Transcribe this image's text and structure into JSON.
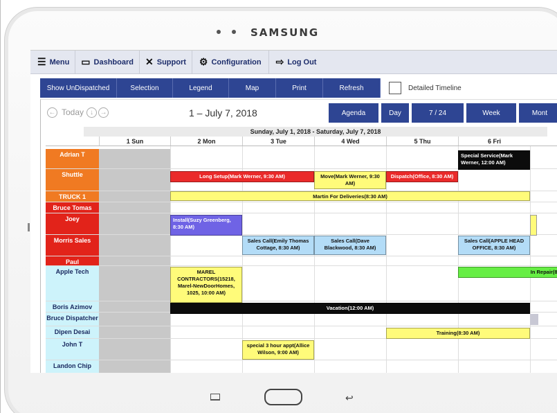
{
  "device": {
    "brand": "SAMSUNG"
  },
  "menu": [
    {
      "label": "Menu",
      "icon": "hamburger-icon"
    },
    {
      "label": "Dashboard",
      "icon": "chart-icon"
    },
    {
      "label": "Support",
      "icon": "tools-icon"
    },
    {
      "label": "Configuration",
      "icon": "gears-icon"
    },
    {
      "label": "Log Out",
      "icon": "logout-icon"
    }
  ],
  "toolbar": {
    "buttons": [
      "Show UnDispatched",
      "Selection",
      "Legend",
      "Map",
      "Print",
      "Refresh"
    ],
    "detailed_timeline": "Detailed Timeline"
  },
  "nav": {
    "today": "Today",
    "range": "1 – July 7, 2018",
    "views": [
      "Agenda",
      "Day",
      "7 / 24",
      "Week",
      "Mont"
    ]
  },
  "week_header": "Sunday, July 1, 2018 - Saturday, July 7, 2018",
  "days": [
    "1 Sun",
    "2 Mon",
    "3 Tue",
    "4 Wed",
    "5 Thu",
    "6 Fri"
  ],
  "colors": {
    "accent": "#2e4593",
    "resource_orange": "#f07a22",
    "resource_red": "#e2231a",
    "resource_cyan": "#cdf3fb",
    "event_yellow": "#fffb7a",
    "event_red": "#ea2a2a",
    "event_blue": "#b3dcf7",
    "event_purple": "#6f63e5",
    "event_green": "#66ee44",
    "event_black": "#0c0c0c"
  },
  "resources": [
    {
      "name": "Adrian T",
      "color": "#f07a22"
    },
    {
      "name": "Shuttle",
      "color": "#f07a22"
    },
    {
      "name": "TRUCK 1",
      "color": "#f07a22"
    },
    {
      "name": "Bruce Tomas",
      "color": "#e2231a"
    },
    {
      "name": "Joey",
      "color": "#e2231a"
    },
    {
      "name": "Morris Sales",
      "color": "#e2231a"
    },
    {
      "name": "Paul",
      "color": "#e2231a"
    },
    {
      "name": "Apple Tech",
      "color": "#cdf3fb"
    },
    {
      "name": "Boris Azimov",
      "color": "#cdf3fb"
    },
    {
      "name": "Bruce Dispatcher",
      "color": "#cdf3fb"
    },
    {
      "name": "Dipen Desai",
      "color": "#cdf3fb"
    },
    {
      "name": "John T",
      "color": "#cdf3fb"
    },
    {
      "name": "Landon Chip",
      "color": "#cdf3fb"
    }
  ],
  "events": [
    {
      "resource": "Adrian T",
      "title": "Special Service(Mark Werner, 12:00 AM)"
    },
    {
      "resource": "Shuttle",
      "title": "Long Setup(Mark Werner, 9:30 AM)"
    },
    {
      "resource": "Shuttle",
      "title": "Move(Mark Werner, 9:30 AM)"
    },
    {
      "resource": "Shuttle",
      "title": "Dispatch(Office, 8:30 AM)"
    },
    {
      "resource": "TRUCK 1",
      "title": "Martin For Deliveries(8:30 AM)"
    },
    {
      "resource": "Joey",
      "title": "Install(Suzy Greenberg, 8:30 AM)"
    },
    {
      "resource": "Morris Sales",
      "title": "Sales Call(Emily Thomas Cottage, 8:30 AM)"
    },
    {
      "resource": "Morris Sales",
      "title": "Sales Call(Dave Blackwood, 8:30 AM)"
    },
    {
      "resource": "Morris Sales",
      "title": "Sales Call(APPLE HEAD OFFICE, 8:30 AM)"
    },
    {
      "resource": "Apple Tech",
      "title": "MAREL CONTRACTORS(15218, Marel-NewDoorHomes, 1025, 10:00 AM)"
    },
    {
      "resource": "Apple Tech",
      "title": "In Repair(8:"
    },
    {
      "resource": "Boris Azimov",
      "title": "Vacation(12:00 AM)"
    },
    {
      "resource": "Dipen Desai",
      "title": "Training(8:30 AM)"
    },
    {
      "resource": "John T",
      "title": "special 3 hour appt(Allice Wilson, 9:00 AM)"
    }
  ]
}
